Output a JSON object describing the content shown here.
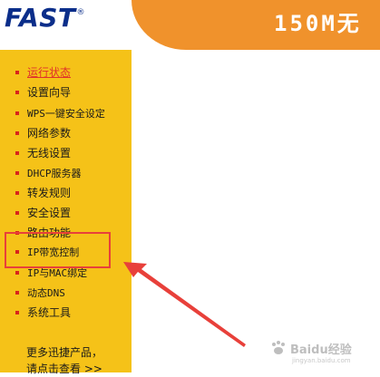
{
  "header": {
    "logo_text": "FAST",
    "logo_reg": "®",
    "model_title": "150M无"
  },
  "sidebar": {
    "items": [
      {
        "label": "运行状态",
        "active": true
      },
      {
        "label": "设置向导",
        "active": false
      },
      {
        "label": "WPS一键安全设定",
        "active": false
      },
      {
        "label": "网络参数",
        "active": false
      },
      {
        "label": "无线设置",
        "active": false
      },
      {
        "label": "DHCP服务器",
        "active": false
      },
      {
        "label": "转发规则",
        "active": false
      },
      {
        "label": "安全设置",
        "active": false
      },
      {
        "label": "路由功能",
        "active": false
      },
      {
        "label": "IP带宽控制",
        "active": false
      },
      {
        "label": "IP与MAC绑定",
        "active": false
      },
      {
        "label": "动态DNS",
        "active": false
      },
      {
        "label": "系统工具",
        "active": false
      }
    ],
    "more_line1": "更多迅捷产品，",
    "more_line2": "请点击查看 >>"
  },
  "watermark": {
    "text": "Baidu经验",
    "sub": "jingyan.baidu.com"
  },
  "colors": {
    "sidebar_bg": "#f5c218",
    "header_band": "#f0922c",
    "logo": "#0b2e8a",
    "bullet": "#d8231b",
    "active_link": "#e0322a",
    "annotation": "#e8403a"
  }
}
